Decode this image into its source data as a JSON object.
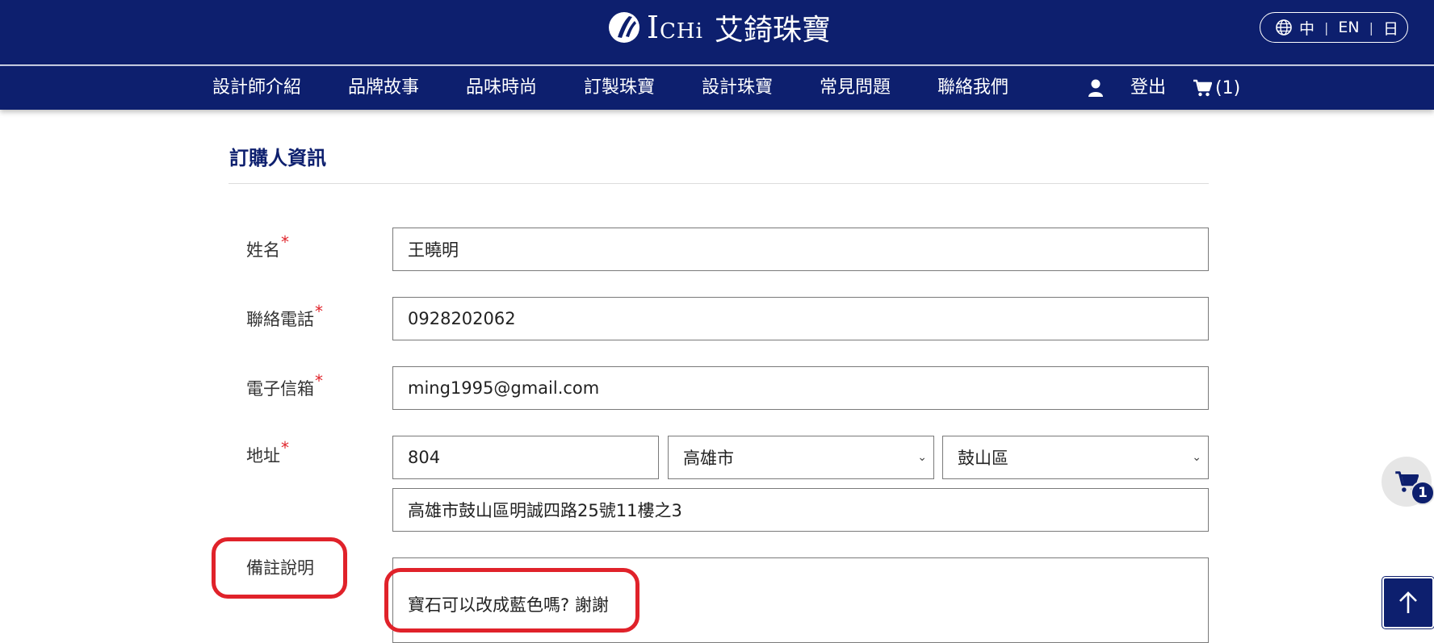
{
  "brand": {
    "logo_latin_first": "I",
    "logo_latin_rest": "CHi",
    "logo_cjk": "艾錡珠寶"
  },
  "languages": [
    "中",
    "EN",
    "日"
  ],
  "nav": {
    "items": [
      "設計師介紹",
      "品牌故事",
      "品味時尚",
      "訂製珠寶",
      "設計珠寶",
      "常見問題",
      "聯絡我們"
    ],
    "logout": "登出",
    "cart_count": "(1)"
  },
  "section": {
    "title": "訂購人資訊"
  },
  "form": {
    "name_label": "姓名",
    "name_value": "王曉明",
    "phone_label": "聯絡電話",
    "phone_value": "0928202062",
    "email_label": "電子信箱",
    "email_value": "ming1995@gmail.com",
    "address_label": "地址",
    "zip_value": "804",
    "city_value": "高雄市",
    "district_value": "鼓山區",
    "street_value": "高雄市鼓山區明誠四路25號11樓之3",
    "note_label": "備註說明",
    "note_value": "寶石可以改成藍色嗎? 謝謝",
    "required_mark": "*"
  },
  "floating_cart_badge": "1",
  "icons": {
    "globe": "globe-icon",
    "user": "user-icon",
    "cart": "cart-icon",
    "back_to_top": "arrow-up-icon"
  },
  "colors": {
    "brand_navy": "#0d1f6e",
    "required_red": "#e0242b",
    "highlight_red": "#e0222a"
  }
}
